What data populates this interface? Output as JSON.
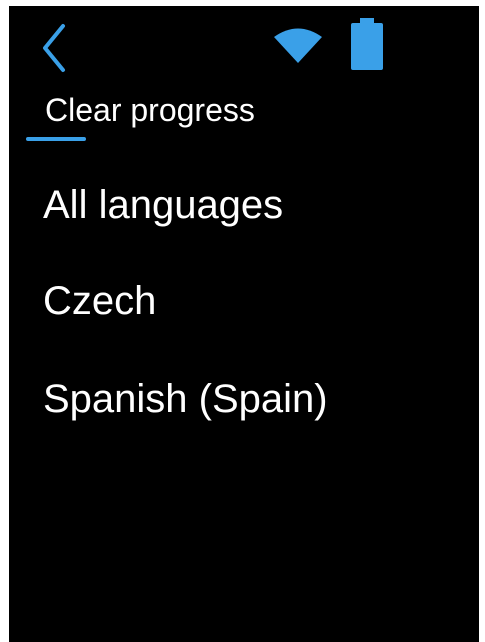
{
  "status_bar": {
    "back_icon": "chevron-left-icon",
    "wifi_icon": "wifi-icon",
    "battery_icon": "battery-icon"
  },
  "header": {
    "title": "Clear progress"
  },
  "menu": {
    "items": [
      {
        "label": "All languages"
      },
      {
        "label": "Czech"
      },
      {
        "label": "Spanish (Spain)"
      }
    ]
  },
  "colors": {
    "background": "#000000",
    "accent": "#3aa0e8",
    "text": "#ffffff"
  }
}
